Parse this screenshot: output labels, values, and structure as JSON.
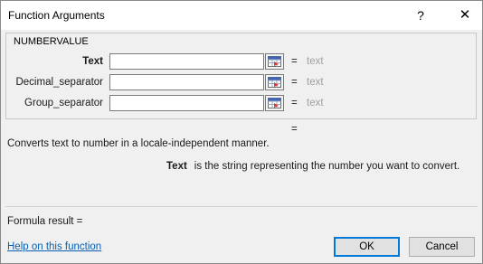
{
  "window": {
    "title": "Function Arguments",
    "help_glyph": "?",
    "close_glyph": "✕"
  },
  "function": {
    "name": "NUMBERVALUE",
    "arguments": [
      {
        "label": "Text",
        "bold": true,
        "value": "",
        "equals": "=",
        "hint": "text"
      },
      {
        "label": "Decimal_separator",
        "bold": false,
        "value": "",
        "equals": "=",
        "hint": "text"
      },
      {
        "label": "Group_separator",
        "bold": false,
        "value": "",
        "equals": "=",
        "hint": "text"
      }
    ],
    "result_equals": "=",
    "description": "Converts text to number in a locale-independent manner.",
    "current_argument": {
      "name": "Text",
      "description": "is the string representing the number you want to convert."
    }
  },
  "footer": {
    "formula_result": "Formula result =",
    "help_link": "Help on this function",
    "ok_label": "OK",
    "cancel_label": "Cancel"
  },
  "icons": {
    "reference": "range-reference-icon"
  },
  "colors": {
    "link": "#0b5fb0",
    "ok_border": "#0078d7",
    "hint_text": "#a0a0a0"
  }
}
